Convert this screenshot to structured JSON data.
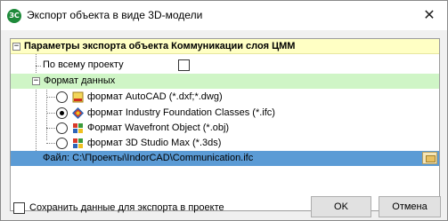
{
  "window": {
    "title": "Экспорт объекта в виде 3D-модели",
    "app_icon_glyph": "ЗС",
    "close_glyph": "✕"
  },
  "tree": {
    "header_label": "Параметры экспорта объекта Коммуникации слоя ЦММ",
    "whole_project_label": "По всему проекту",
    "whole_project_checked": false,
    "format_group_label": "Формат данных",
    "formats": [
      {
        "label": "формат AutoCAD (*.dxf;*.dwg)",
        "checked": false,
        "icon": "autocad-icon"
      },
      {
        "label": "формат Industry Foundation Classes (*.ifc)",
        "checked": true,
        "icon": "ifc-icon"
      },
      {
        "label": "Формат Wavefront Object (*.obj)",
        "checked": false,
        "icon": "wavefront-icon"
      },
      {
        "label": "формат 3D Studio Max (*.3ds)",
        "checked": false,
        "icon": "3dsmax-icon"
      }
    ],
    "file_label": "Файл: C:\\Проекты\\IndorCAD\\Communication.ifc"
  },
  "footer": {
    "save_label": "Сохранить данные для экспорта в проекте",
    "save_checked": false,
    "ok_label": "OK",
    "cancel_label": "Отмена"
  },
  "colors": {
    "header_bg": "#ffffc4",
    "format_bg": "#cff5c6",
    "file_selected_bg": "#5b9bd5"
  }
}
